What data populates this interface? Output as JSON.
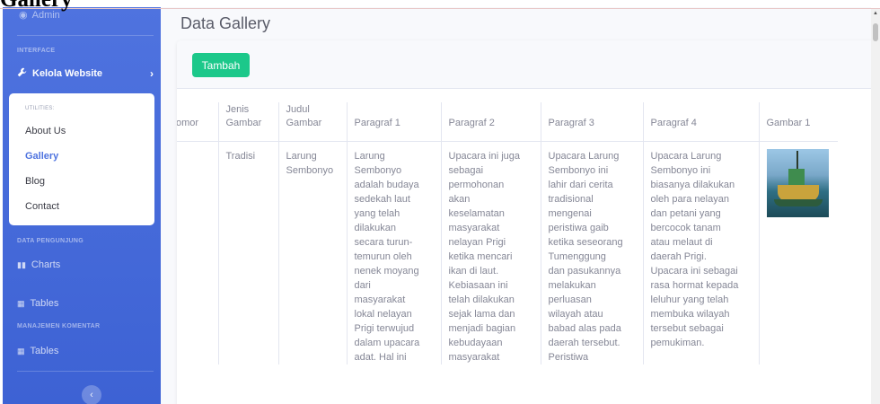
{
  "document": {
    "heading": "Gallery"
  },
  "sidebar": {
    "admin_label": "Admin",
    "heading_interface": "INTERFACE",
    "kelola_label": "Kelola Website",
    "utilities_heading": "UTILITIES:",
    "utilities_items": [
      "About Us",
      "Gallery",
      "Blog",
      "Contact"
    ],
    "heading_data": "DATA PENGUNJUNG",
    "charts_label": "Charts",
    "tables_label_1": "Tables",
    "heading_komentar": "MANAJEMEN KOMENTAR",
    "tables_label_2": "Tables"
  },
  "main": {
    "page_title": "Data Gallery",
    "add_button": "Tambah",
    "table": {
      "headers": [
        "omor",
        "Jenis\nGambar",
        "Judul\nGambar",
        "Paragraf 1",
        "Paragraf 2",
        "Paragraf 3",
        "Paragraf 4",
        "Gambar 1"
      ],
      "rows": [
        {
          "nomor": "",
          "jenis": "Tradisi",
          "judul": "Larung\nSembonyo",
          "p1": "Larung\nSembonyo\nadalah budaya\nsedekah laut\nyang telah\ndilakukan\nsecara turun-\ntemurun oleh\nnenek moyang\ndari\nmasyarakat\nlokal nelayan\nPrigi terwujud\ndalam upacara\nadat. Hal ini",
          "p2": "Upacara ini juga\nsebagai\npermohonan\nakan\nkeselamatan\nmasyarakat\nnelayan Prigi\nketika mencari\nikan di laut.\nKebiasaan ini\ntelah dilakukan\nsejak lama dan\nmenjadi bagian\nkebudayaan\nmasyarakat",
          "p3": "Upacara Larung\nSembonyo ini\nlahir dari cerita\ntradisional\nmengenai\nperistiwa gaib\nketika seseorang\nTumenggung\ndan pasukannya\nmelakukan\nperluasan\nwilayah atau\nbabad alas pada\ndaerah tersebut.\nPeristiwa",
          "p4": "Upacara Larung\nSembonyo ini\nbiasanya dilakukan\noleh para nelayan\ndan petani yang\nbercocok tanam\natau melaut di\ndaerah Prigi.\nUpacara ini sebagai\nrasa hormat kepada\nleluhur yang telah\nmembuka wilayah\ntersebut sebagai\npemukiman."
        }
      ]
    }
  },
  "colors": {
    "sidebar": "#4e73df",
    "accent_button": "#1cc88a",
    "active_link": "#4e73df"
  }
}
